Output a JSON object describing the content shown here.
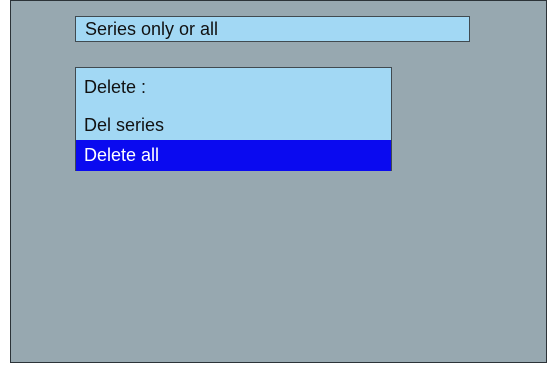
{
  "title_bar": {
    "label": "Series only or all"
  },
  "menu": {
    "header": "Delete :",
    "items": [
      {
        "label": "Del series",
        "selected": false
      },
      {
        "label": "Delete all",
        "selected": true
      }
    ]
  },
  "colors": {
    "screen_bg": "#97a8b0",
    "panel_bg": "#a2d8f4",
    "selection_bg": "#0a0af0",
    "selection_text": "#ffffff"
  }
}
